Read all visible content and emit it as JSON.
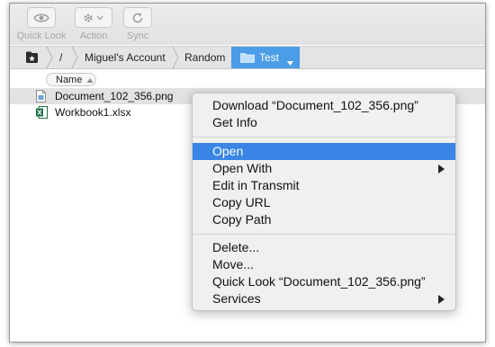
{
  "toolbar": {
    "quick_look": "Quick Look",
    "action": "Action",
    "sync": "Sync"
  },
  "breadcrumb": {
    "root": "/",
    "items": [
      "Miguel's Account",
      "Random"
    ],
    "active": "Test"
  },
  "list": {
    "sort_column": "Name",
    "files": [
      "Document_102_356.png",
      "Workbook1.xlsx"
    ]
  },
  "context_menu": {
    "download": "Download “Document_102_356.png”",
    "get_info": "Get Info",
    "open": "Open",
    "open_with": "Open With",
    "edit_in_transmit": "Edit in Transmit",
    "copy_url": "Copy URL",
    "copy_path": "Copy Path",
    "delete": "Delete...",
    "move": "Move...",
    "quick_look": "Quick Look “Document_102_356.png”",
    "services": "Services"
  },
  "colors": {
    "accent": "#3a86e6",
    "active_crumb": "#4a9de6",
    "excel_green": "#1e7145"
  }
}
